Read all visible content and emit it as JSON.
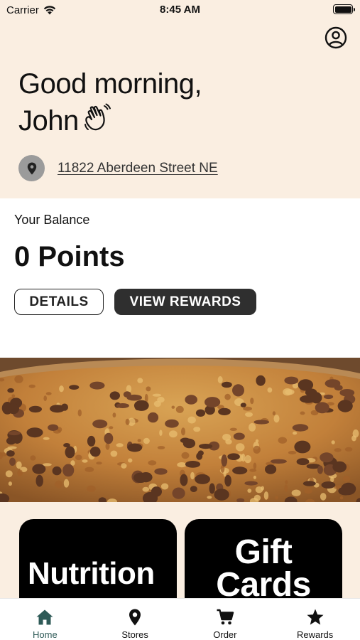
{
  "status_bar": {
    "carrier": "Carrier",
    "time": "8:45 AM"
  },
  "header": {
    "greeting_line1": "Good morning,",
    "greeting_name": "John",
    "address": "11822 Aberdeen Street NE",
    "icons": [
      "profile-icon",
      "waving-hand-icon",
      "location-pin-icon"
    ]
  },
  "balance": {
    "label": "Your Balance",
    "points": "0 Points",
    "details_label": "DETAILS",
    "view_rewards_label": "VIEW REWARDS"
  },
  "tiles": {
    "nutrition": "Nutrition",
    "gift_cards": "Gift Cards"
  },
  "tabbar": {
    "active": "Home",
    "items": [
      {
        "label": "Home",
        "icon": "home-icon"
      },
      {
        "label": "Stores",
        "icon": "location-pin-icon"
      },
      {
        "label": "Order",
        "icon": "cart-icon"
      },
      {
        "label": "Rewards",
        "icon": "star-icon"
      }
    ]
  },
  "colors": {
    "cream": "#faeee1",
    "dark_button": "#2f2f2f",
    "active_tab": "#2e5a57",
    "pin_circle": "#9b9b9b"
  }
}
